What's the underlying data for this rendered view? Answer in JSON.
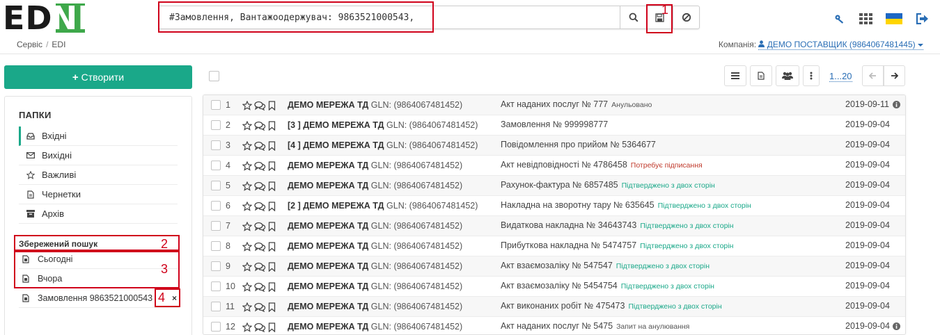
{
  "logo": {
    "left": "ED",
    "right": "NI"
  },
  "search": {
    "value": "#Замовлення, Вантажоодержувач: 9863521000543,"
  },
  "breadcrumb": {
    "items": [
      "Сервіс",
      "EDI"
    ]
  },
  "company": {
    "label": "Компанія:",
    "name": "ДЕМО ПОСТАВЩИК (9864067481445)"
  },
  "sidebar": {
    "create_label": "Створити",
    "folders_title": "ПАПКИ",
    "folders": [
      {
        "label": "Вхідні",
        "icon": "inbox-icon"
      },
      {
        "label": "Вихідні",
        "icon": "envelope-icon"
      },
      {
        "label": "Важливі",
        "icon": "star-icon"
      },
      {
        "label": "Чернетки",
        "icon": "document-icon"
      },
      {
        "label": "Архів",
        "icon": "archive-icon"
      }
    ],
    "saved_title": "Збережений пошук",
    "saved": [
      {
        "label": "Сьогодні"
      },
      {
        "label": "Вчора"
      },
      {
        "label": "Замовлення 9863521000543"
      }
    ],
    "remove_symbol": "×"
  },
  "pager": {
    "label": "1...20"
  },
  "annotations": [
    "1",
    "2",
    "3",
    "4"
  ],
  "colors": {
    "accent": "#1aa889",
    "link": "#2a6eb5",
    "annotation": "#d0021b",
    "status_green": "#1aa889",
    "status_red": "#c0392b"
  },
  "rows": [
    {
      "n": "1",
      "prefix": "",
      "party": "ДЕМО МЕРЕЖА ТД",
      "gln": "GLN: (9864067481452)",
      "doc": "Акт наданих послуг № 777",
      "status": "Анульовано",
      "status_kind": "gray",
      "date": "2019-09-11",
      "info": true
    },
    {
      "n": "2",
      "prefix": "[3 ] ",
      "party": "ДЕМО МЕРЕЖА ТД",
      "gln": "GLN: (9864067481452)",
      "doc": "Замовлення № 999998777",
      "status": "",
      "status_kind": "",
      "date": "2019-09-04",
      "info": false
    },
    {
      "n": "3",
      "prefix": "[4 ] ",
      "party": "ДЕМО МЕРЕЖА ТД",
      "gln": "GLN: (9864067481452)",
      "doc": "Повідомлення про прийом № 5364677",
      "status": "",
      "status_kind": "",
      "date": "2019-09-04",
      "info": false
    },
    {
      "n": "4",
      "prefix": "",
      "party": "ДЕМО МЕРЕЖА ТД",
      "gln": "GLN: (9864067481452)",
      "doc": "Акт невідповідності № 4786458",
      "status": "Потребує підписання",
      "status_kind": "red",
      "date": "2019-09-04",
      "info": false
    },
    {
      "n": "5",
      "prefix": "",
      "party": "ДЕМО МЕРЕЖА ТД",
      "gln": "GLN: (9864067481452)",
      "doc": "Рахунок-фактура № 6857485",
      "status": "Підтверджено з двох сторін",
      "status_kind": "green",
      "date": "2019-09-04",
      "info": false
    },
    {
      "n": "6",
      "prefix": "[2 ] ",
      "party": "ДЕМО МЕРЕЖА ТД",
      "gln": "GLN: (9864067481452)",
      "doc": "Накладна на зворотну тару № 635645",
      "status": "Підтверджено з двох сторін",
      "status_kind": "green",
      "date": "2019-09-04",
      "info": false
    },
    {
      "n": "7",
      "prefix": "",
      "party": "ДЕМО МЕРЕЖА ТД",
      "gln": "GLN: (9864067481452)",
      "doc": "Видаткова накладна № 34643743",
      "status": "Підтверджено з двох сторін",
      "status_kind": "green",
      "date": "2019-09-04",
      "info": false
    },
    {
      "n": "8",
      "prefix": "",
      "party": "ДЕМО МЕРЕЖА ТД",
      "gln": "GLN: (9864067481452)",
      "doc": "Прибуткова накладна № 5474757",
      "status": "Підтверджено з двох сторін",
      "status_kind": "green",
      "date": "2019-09-04",
      "info": false
    },
    {
      "n": "9",
      "prefix": "",
      "party": "ДЕМО МЕРЕЖА ТД",
      "gln": "GLN: (9864067481452)",
      "doc": "Акт взаємозаліку № 547547",
      "status": "Підтверджено з двох сторін",
      "status_kind": "green",
      "date": "2019-09-04",
      "info": false
    },
    {
      "n": "10",
      "prefix": "",
      "party": "ДЕМО МЕРЕЖА ТД",
      "gln": "GLN: (9864067481452)",
      "doc": "Акт взаємозаліку № 5454754",
      "status": "Підтверджено з двох сторін",
      "status_kind": "green",
      "date": "2019-09-04",
      "info": false
    },
    {
      "n": "11",
      "prefix": "",
      "party": "ДЕМО МЕРЕЖА ТД",
      "gln": "GLN: (9864067481452)",
      "doc": "Акт виконаних робіт № 475473",
      "status": "Підтверджено з двох сторін",
      "status_kind": "green",
      "date": "2019-09-04",
      "info": false
    },
    {
      "n": "12",
      "prefix": "",
      "party": "ДЕМО МЕРЕЖА ТД",
      "gln": "GLN: (9864067481452)",
      "doc": "Акт наданих послуг № 5475",
      "status": "Запит на анулювання",
      "status_kind": "gray",
      "date": "2019-09-04",
      "info": true
    }
  ]
}
